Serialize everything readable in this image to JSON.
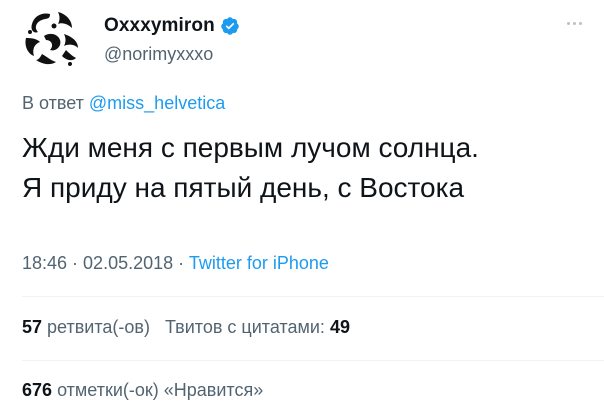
{
  "author": {
    "display_name": "Oxxxymiron",
    "handle": "@norimyxxxo",
    "verified_icon": "verified-badge-icon",
    "avatar_icon": "abstract-black-white-avatar"
  },
  "reply": {
    "prefix": "В ответ",
    "mention": "@miss_helvetica"
  },
  "tweet": {
    "text": "Жди меня с первым лучом солнца.\nЯ приду на пятый день, с Востока"
  },
  "meta": {
    "time": "18:46",
    "separator": " · ",
    "date": "02.05.2018",
    "separator2": " · ",
    "source": "Twitter for iPhone"
  },
  "stats": {
    "retweets_count": "57",
    "retweets_label": "ретвита(-ов)",
    "quotes_label": "Твитов с цитатами:",
    "quotes_count": "49",
    "likes_count": "676",
    "likes_label": "отметки(-ок) «Нравится»"
  },
  "colors": {
    "text": "#0f1419",
    "secondary": "#536471",
    "accent": "#1d9bf0",
    "divider": "#eff3f4"
  }
}
